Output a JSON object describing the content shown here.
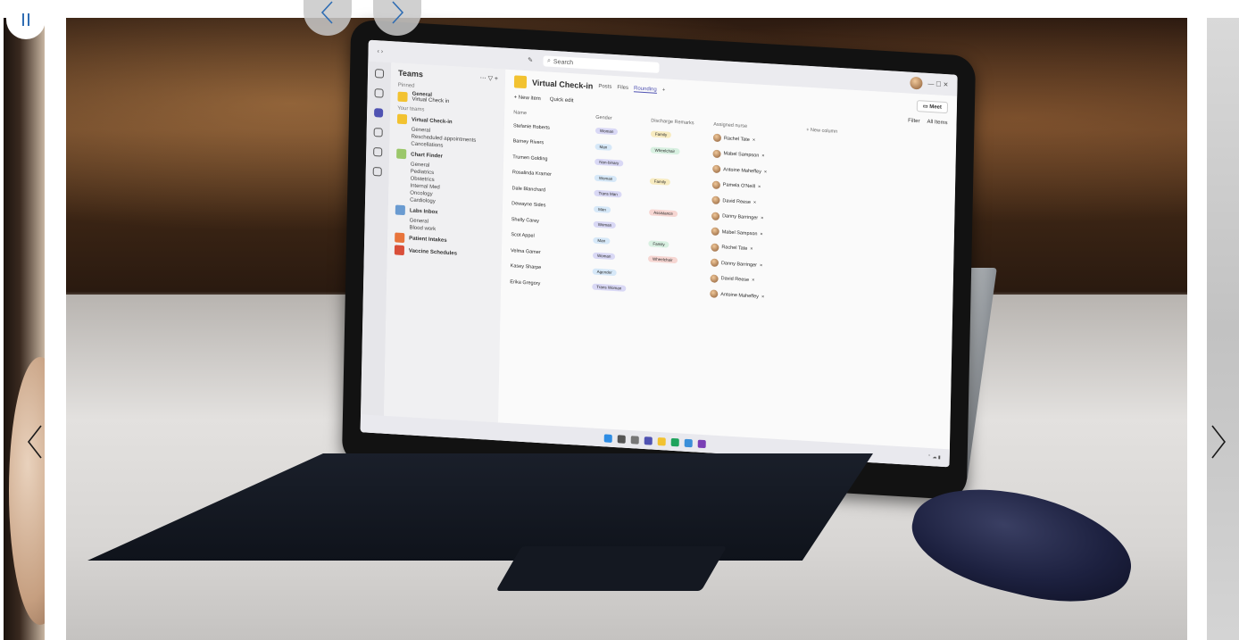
{
  "carousel": {
    "pause_icon": "pause-icon",
    "prev_icon": "chevron-left-icon",
    "next_icon": "chevron-right-icon"
  },
  "screen": {
    "search": "Search",
    "teams": {
      "title": "Teams",
      "pinned_label": "Pinned",
      "pinned": [
        {
          "name": "General",
          "sub": "Virtual Check in"
        }
      ],
      "your_teams_label": "Your teams",
      "teams": [
        {
          "name": "Virtual Check-in",
          "color": "#f2c230",
          "channels": [
            "General",
            "Rescheduled appointments",
            "Cancellations"
          ]
        },
        {
          "name": "Chart Finder",
          "color": "#9bc76a",
          "channels": [
            "General",
            "Pediatrics",
            "Obstetrics",
            "Internal Med",
            "Oncology",
            "Cardiology"
          ]
        },
        {
          "name": "Labs Inbox",
          "color": "#6a9bd1",
          "channels": [
            "General",
            "Blood work"
          ]
        },
        {
          "name": "Patient Intakes",
          "color": "#e8743b",
          "channels": []
        },
        {
          "name": "Vaccine Schedules",
          "color": "#d94f3a",
          "channels": []
        }
      ]
    },
    "channel": {
      "title": "Virtual Check-in",
      "tabs": [
        "Posts",
        "Files",
        "Rounding",
        "+"
      ],
      "meet": "Meet"
    },
    "toolbar": {
      "new_item": "+ New item",
      "quick_edit": "Quick edit",
      "filter": "Filter",
      "all_items": "All Items"
    },
    "grid": {
      "columns": [
        "Name",
        "Gender",
        "Discharge Remarks",
        "Assigned nurse",
        "+ New column"
      ],
      "rows": [
        {
          "name": "Stefanie Roberts",
          "gender": "Woman",
          "remark": "Family",
          "nurse": "Rachel Tate"
        },
        {
          "name": "Barney Rivers",
          "gender": "Man",
          "remark": "Wheelchair",
          "nurse": "Mabel Sampson"
        },
        {
          "name": "Trumen Golding",
          "gender": "Non-binary",
          "remark": "",
          "nurse": "Antoine Maheffey"
        },
        {
          "name": "Rosalinda Kramer",
          "gender": "Woman",
          "remark": "Family",
          "nurse": "Pamela O'Neill"
        },
        {
          "name": "Dale Blanchard",
          "gender": "Trans Man",
          "remark": "",
          "nurse": "David Reese"
        },
        {
          "name": "Dewayne Sides",
          "gender": "Man",
          "remark": "Assistance",
          "nurse": "Danny Barringer"
        },
        {
          "name": "Shelly Carey",
          "gender": "Woman",
          "remark": "",
          "nurse": "Mabel Sampson"
        },
        {
          "name": "Scot Appel",
          "gender": "Man",
          "remark": "Family",
          "nurse": "Rachel Tate"
        },
        {
          "name": "Velma Gamer",
          "gender": "Woman",
          "remark": "Wheelchair",
          "nurse": "Danny Barringer"
        },
        {
          "name": "Kasey Sharpe",
          "gender": "Agender",
          "remark": "",
          "nurse": "David Reese"
        },
        {
          "name": "Erika Gregory",
          "gender": "Trans Woman",
          "remark": "",
          "nurse": "Antoine Maheffey"
        }
      ]
    }
  },
  "colors": {
    "accent": "#2f6db3",
    "teams_purple": "#4f52b2"
  }
}
